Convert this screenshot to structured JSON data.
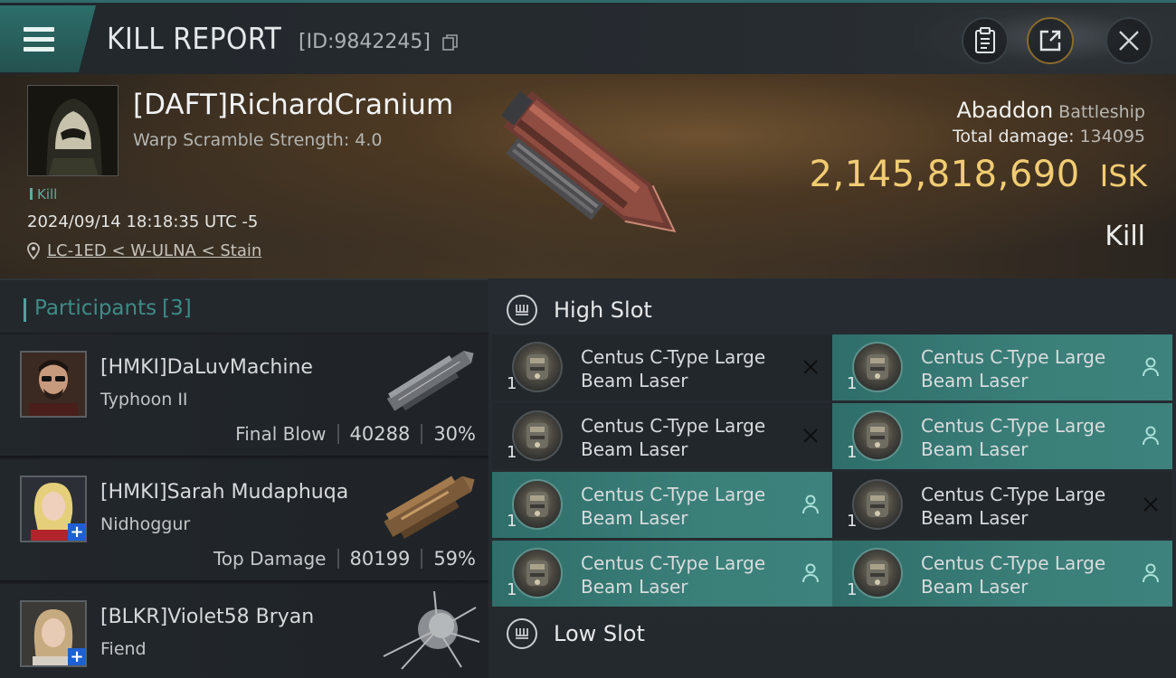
{
  "header": {
    "title": "KILL REPORT",
    "report_id": "[ID:9842245]",
    "icons": [
      "menu-icon",
      "copy-icon",
      "clipboard-icon",
      "share-icon",
      "close-icon"
    ]
  },
  "victim": {
    "name": "[DAFT]RichardCranium",
    "warp_scramble": "Warp Scramble Strength: 4.0",
    "tag": "Kill",
    "datetime": "2024/09/14 18:18:35 UTC -5",
    "location": "LC-1ED < W-ULNA < Stain",
    "ship_name": "Abaddon",
    "ship_class": "Battleship",
    "total_damage_label": "Total damage:",
    "total_damage": "134095",
    "isk_value": "2,145,818,690",
    "isk_unit": "ISK",
    "kill_type": "Kill"
  },
  "participants": {
    "title": "Participants",
    "count": "[3]",
    "items": [
      {
        "name": "[HMKI]DaLuvMachine",
        "ship": "Typhoon II",
        "role": "Final Blow",
        "damage": "40288",
        "percent": "30%",
        "has_plus": false
      },
      {
        "name": "[HMKI]Sarah Mudaphuqa",
        "ship": "Nidhoggur",
        "role": "Top Damage",
        "damage": "80199",
        "percent": "59%",
        "has_plus": true
      },
      {
        "name": "[BLKR]Violet58 Bryan",
        "ship": "Fiend",
        "role": "",
        "damage": "",
        "percent": "",
        "has_plus": true
      }
    ]
  },
  "fitting": {
    "high_slot_title": "High Slot",
    "low_slot_title": "Low Slot",
    "high_modules": [
      {
        "qty": "1",
        "line1": "Centus C-Type Large",
        "line2": "Beam Laser",
        "status": "destroyed"
      },
      {
        "qty": "1",
        "line1": "Centus C-Type Large",
        "line2": "Beam Laser",
        "status": "dropped"
      },
      {
        "qty": "1",
        "line1": "Centus C-Type Large",
        "line2": "Beam Laser",
        "status": "destroyed"
      },
      {
        "qty": "1",
        "line1": "Centus C-Type Large",
        "line2": "Beam Laser",
        "status": "dropped"
      },
      {
        "qty": "1",
        "line1": "Centus C-Type Large",
        "line2": "Beam Laser",
        "status": "dropped"
      },
      {
        "qty": "1",
        "line1": "Centus C-Type Large",
        "line2": "Beam Laser",
        "status": "destroyed"
      },
      {
        "qty": "1",
        "line1": "Centus C-Type Large",
        "line2": "Beam Laser",
        "status": "dropped"
      },
      {
        "qty": "1",
        "line1": "Centus C-Type Large",
        "line2": "Beam Laser",
        "status": "dropped"
      }
    ]
  },
  "colors": {
    "accent_teal": "#3b7f79",
    "isk_gold": "#f1cc72",
    "dark_panel": "#22272c"
  }
}
